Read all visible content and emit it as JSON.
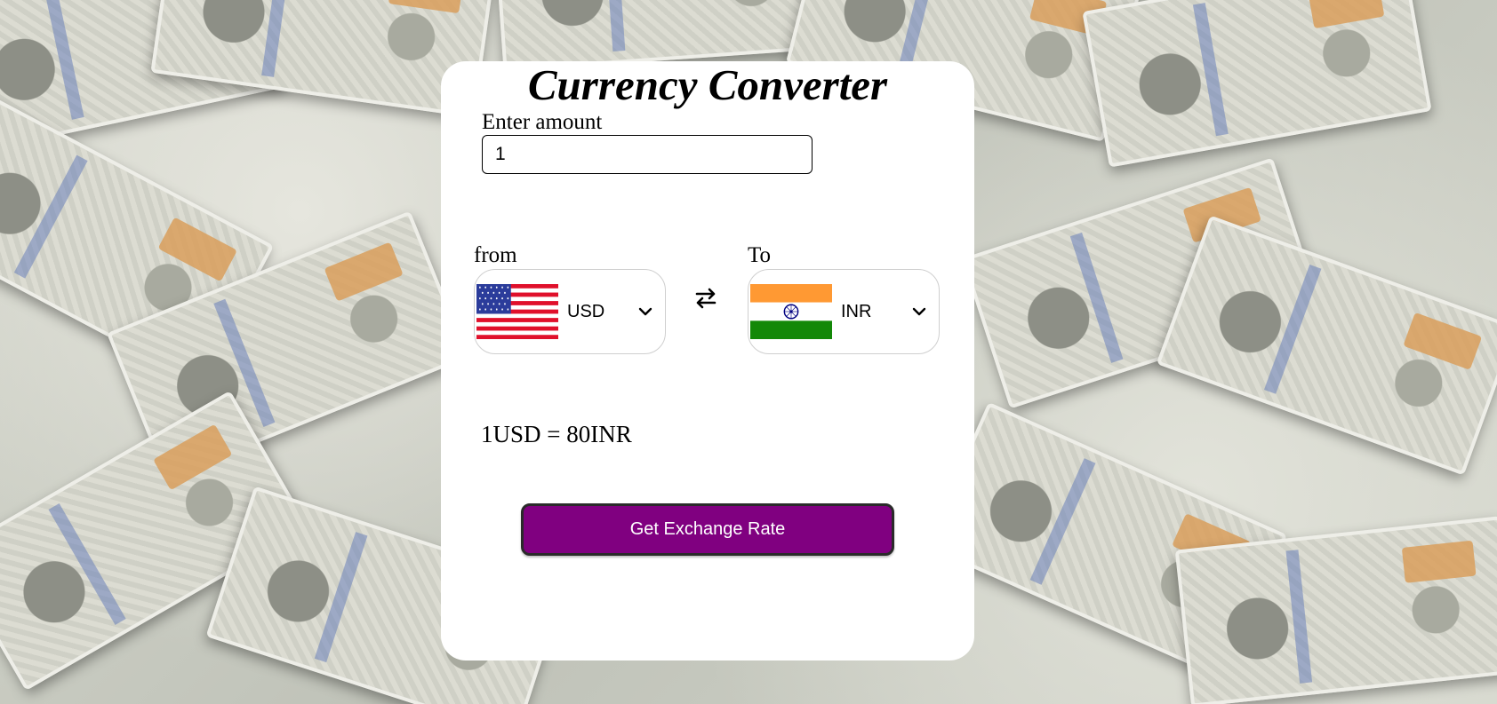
{
  "app": {
    "title": "Currency Converter"
  },
  "amount": {
    "label": "Enter amount",
    "value": "1"
  },
  "from": {
    "label": "from",
    "currency": "USD",
    "flag_icon": "us-flag-icon"
  },
  "to": {
    "label": "To",
    "currency": "INR",
    "flag_icon": "india-flag-icon"
  },
  "swap": {
    "icon": "swap-arrows-icon"
  },
  "result": {
    "text": "1USD = 80INR"
  },
  "actions": {
    "get_rate_label": "Get Exchange Rate"
  },
  "colors": {
    "button_bg": "#800080",
    "card_bg": "#ffffff"
  }
}
